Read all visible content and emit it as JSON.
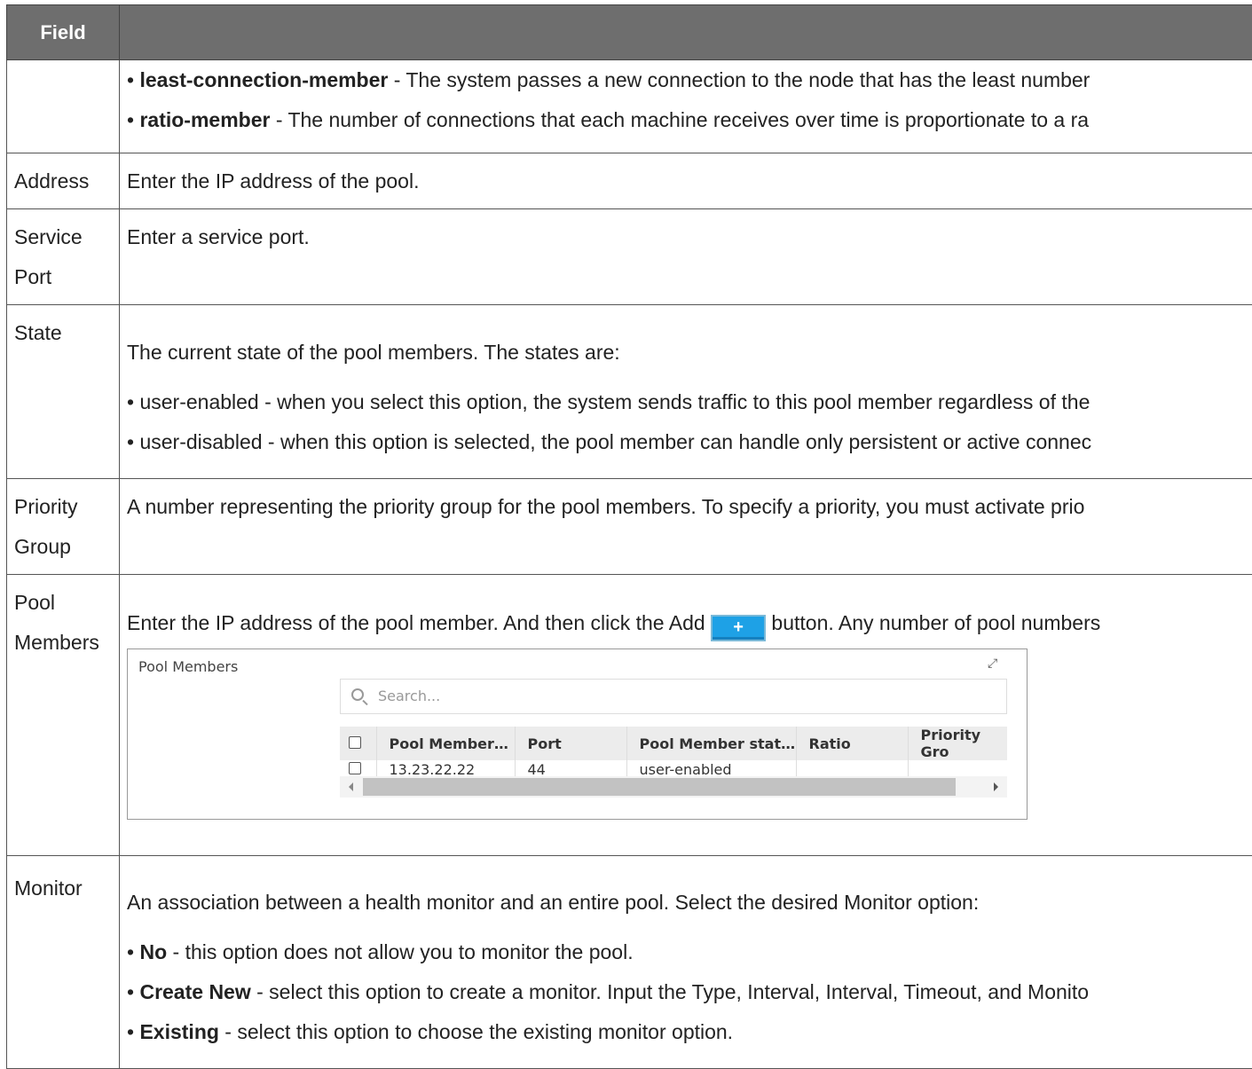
{
  "table": {
    "header_field": "Field",
    "header_description": "",
    "rows": {
      "lb_method": {
        "field": "",
        "bullets": [
          {
            "bold": "least-connection-member",
            "text": " - The system passes a new connection to the node that has the least number"
          },
          {
            "bold": "ratio-member",
            "text": " - The number of connections that each machine receives over time is proportionate to a ra"
          }
        ]
      },
      "address": {
        "field": "Address",
        "text": "Enter the IP address of the pool."
      },
      "service_port": {
        "field_line1": "Service",
        "field_line2": "Port",
        "text": "Enter a service port."
      },
      "state": {
        "field": "State",
        "intro": "The current state of the pool members. The states are:",
        "bullets": [
          "user-enabled - when you select this option, the system sends traffic to this pool member regardless of the",
          "user-disabled - when this option is selected, the pool member can handle only persistent or active connec"
        ]
      },
      "priority_group": {
        "field_line1": "Priority",
        "field_line2": "Group",
        "text": "A number representing the priority group for the pool members. To specify a priority, you must activate prio"
      },
      "pool_members": {
        "field_line1": "Pool",
        "field_line2": "Members",
        "text_before": "Enter the IP address of the pool member. And then click the Add ",
        "add_button": "+",
        "text_after": " button. Any number of pool numbers",
        "widget": {
          "title": "Pool Members",
          "search_placeholder": "Search...",
          "columns": [
            "Pool Member…",
            "Port",
            "Pool Member stat…",
            "Ratio",
            "Priority Gro"
          ],
          "row": [
            "13.23.22.22",
            "44",
            "user-enabled",
            "",
            ""
          ]
        }
      },
      "monitor": {
        "field": "Monitor",
        "intro": "An association between a health monitor and an entire pool. Select the desired Monitor option:",
        "bullets": [
          {
            "bold": "No",
            "text": " - this option does not allow you to monitor the pool."
          },
          {
            "bold": "Create New",
            "text": " - select this option to create a monitor. Input the Type, Interval, Interval, Timeout, and Monito"
          },
          {
            "bold": "Existing",
            "text": " - select this option to choose the existing monitor option."
          }
        ]
      }
    }
  }
}
